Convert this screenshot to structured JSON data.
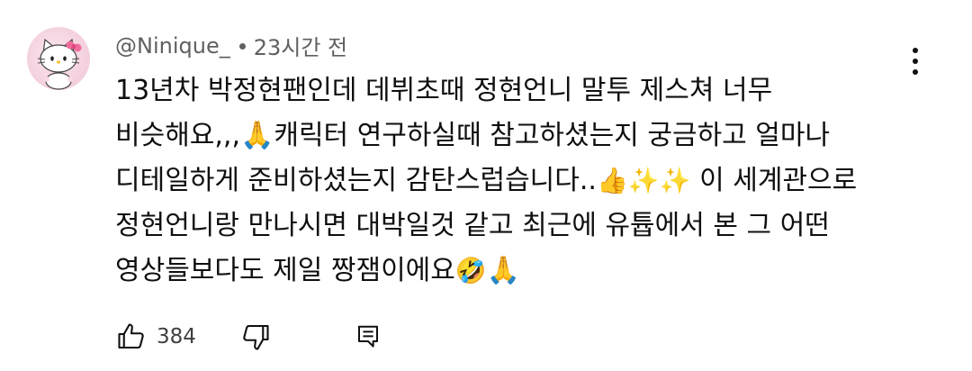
{
  "comment": {
    "author": "@Ninique_",
    "timestamp": "23시간 전",
    "lines": [
      "13년차 박정현팬인데 데뷔초때 정현언니 말투 제스쳐 너무",
      "비슷해요,,,🙏캐릭터 연구하실때 참고하셨는지 궁금하고 얼마나",
      "디테일하게 준비하셨는지 감탄스럽습니다..",
      "이 세계관으로",
      "정현언니랑 만나시면 대박일것 같고 최근에 유튭에서 본 그 어떤",
      "영상들보다도 제일 짱잼이에요",
      "🙏"
    ],
    "emoji": {
      "thumbs_up": "👍",
      "sparkles": "✨✨",
      "rolling_laughing": "🤣"
    }
  },
  "actions": {
    "like_count": "384"
  },
  "icons": {
    "avatar": "hello-kitty-avatar",
    "more": "more-vertical-icon",
    "like": "thumb-up-icon",
    "dislike": "thumb-down-icon",
    "reply": "reply-comment-icon"
  },
  "colors": {
    "text_primary": "#0f0f0f",
    "text_secondary": "#606060",
    "avatar_bg": "#f3cedd"
  }
}
